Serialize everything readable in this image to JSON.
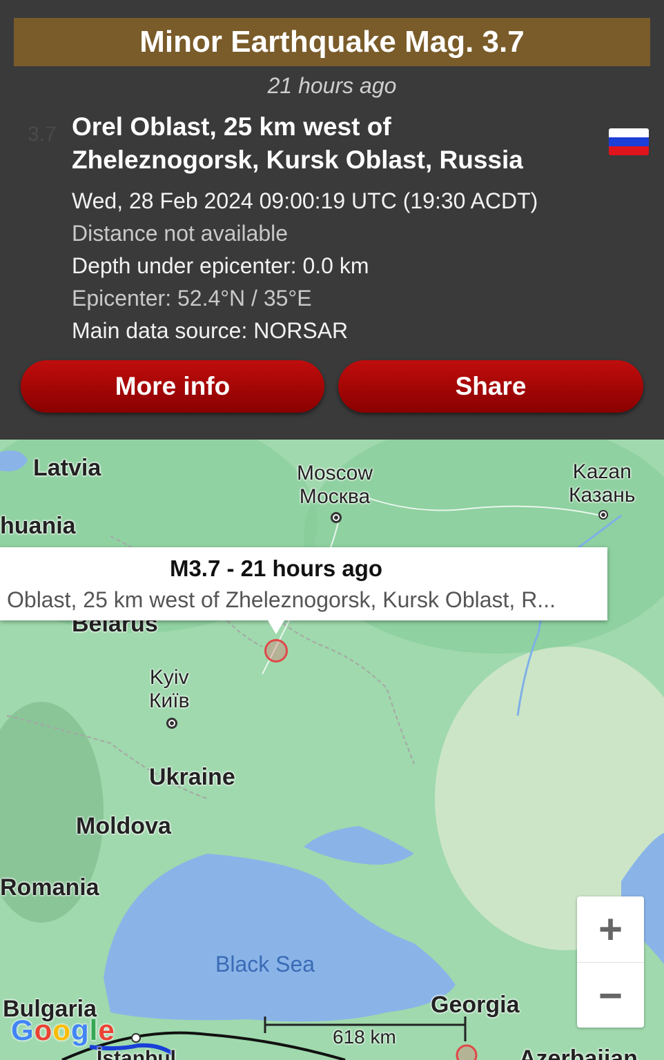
{
  "header": {
    "title": "Minor Earthquake Mag. 3.7",
    "time_ago": "21 hours ago",
    "mag_ghost": "3.7",
    "location": "Orel Oblast, 25 km west of Zheleznogorsk, Kursk Oblast, Russia",
    "flag_colors": [
      "#ffffff",
      "#1c3fd8",
      "#e0141c"
    ]
  },
  "details": {
    "datetime": "Wed, 28 Feb 2024 09:00:19 UTC (19:30 ACDT)",
    "distance": "Distance not available",
    "depth": "Depth under epicenter: 0.0 km",
    "epicenter": "Epicenter: 52.4°N / 35°E",
    "source": "Main data source: NORSAR"
  },
  "buttons": {
    "more_info": "More info",
    "share": "Share"
  },
  "map": {
    "labels": {
      "latvia": "Latvia",
      "lithuania": "huania",
      "moscow_en": "Moscow",
      "moscow_ru": "Москва",
      "kazan_en": "Kazan",
      "kazan_ru": "Казань",
      "belarus": "Belarus",
      "kyiv_en": "Kyiv",
      "kyiv_uk": "Київ",
      "ukraine": "Ukraine",
      "moldova": "Moldova",
      "romania": "Romania",
      "black_sea": "Black Sea",
      "bulgaria": "Bulgaria",
      "georgia": "Georgia",
      "istanbul": "İstanbul",
      "azerbaijan": "Azerbaijan"
    },
    "popup": {
      "title": "M3.7  -  21 hours ago",
      "subtitle": "Oblast, 25 km west of Zheleznogorsk, Kursk Oblast, R..."
    },
    "zoom_in": "+",
    "zoom_out": "−",
    "scale": "618 km",
    "attribution": "Google"
  }
}
